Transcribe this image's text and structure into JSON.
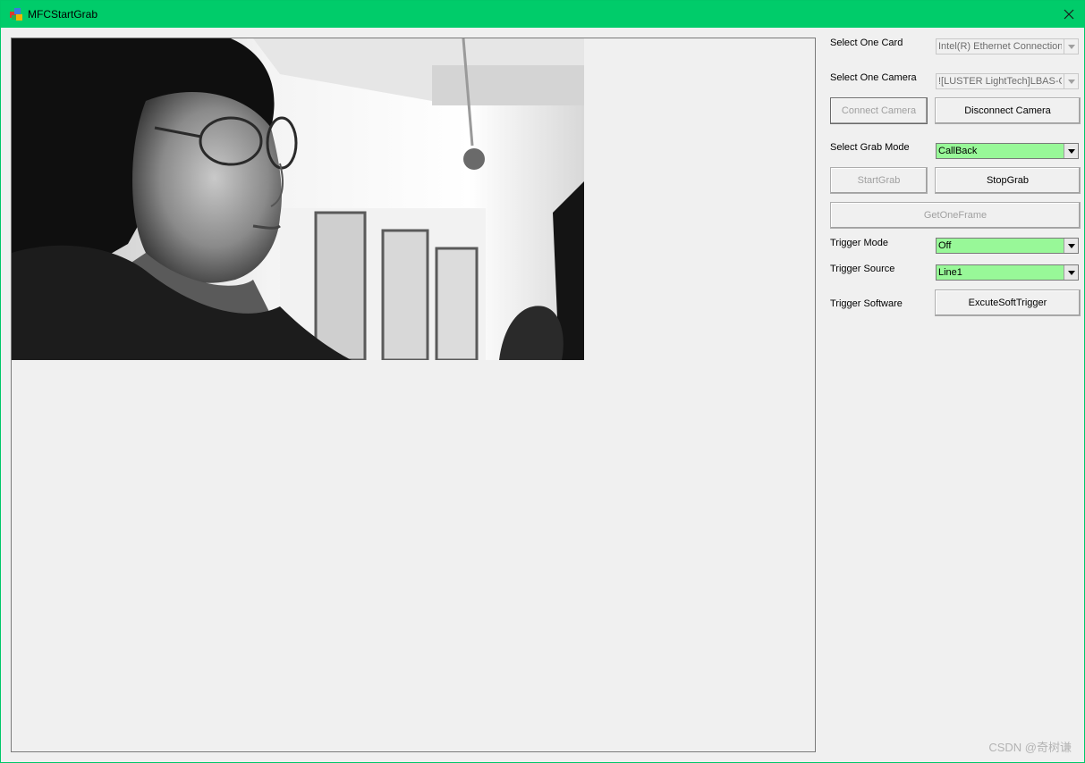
{
  "window": {
    "title": "MFCStartGrab",
    "accent_color": "#00cc6a",
    "close_icon": "close-icon"
  },
  "display": {
    "image_description_icon": "camera-frame-image"
  },
  "controls": {
    "select_card_label": "Select One Card",
    "select_card_value": "Intel(R) Ethernet Connection",
    "select_camera_label": "Select One Camera",
    "select_camera_value": "![LUSTER LightTech]LBAS-GE",
    "connect_camera": "Connect Camera",
    "disconnect_camera": "Disconnect Camera",
    "grab_mode_label": "Select Grab Mode",
    "grab_mode_value": "CallBack",
    "start_grab": "StartGrab",
    "stop_grab": "StopGrab",
    "get_one_frame": "GetOneFrame",
    "trigger_mode_label": "Trigger Mode",
    "trigger_mode_value": "Off",
    "trigger_source_label": "Trigger Source",
    "trigger_source_value": "Line1",
    "trigger_software_label": "Trigger Software",
    "excute_soft_trigger": "ExcuteSoftTrigger",
    "active_combo_color": "#98f898"
  },
  "watermark": "CSDN @奇树谦"
}
